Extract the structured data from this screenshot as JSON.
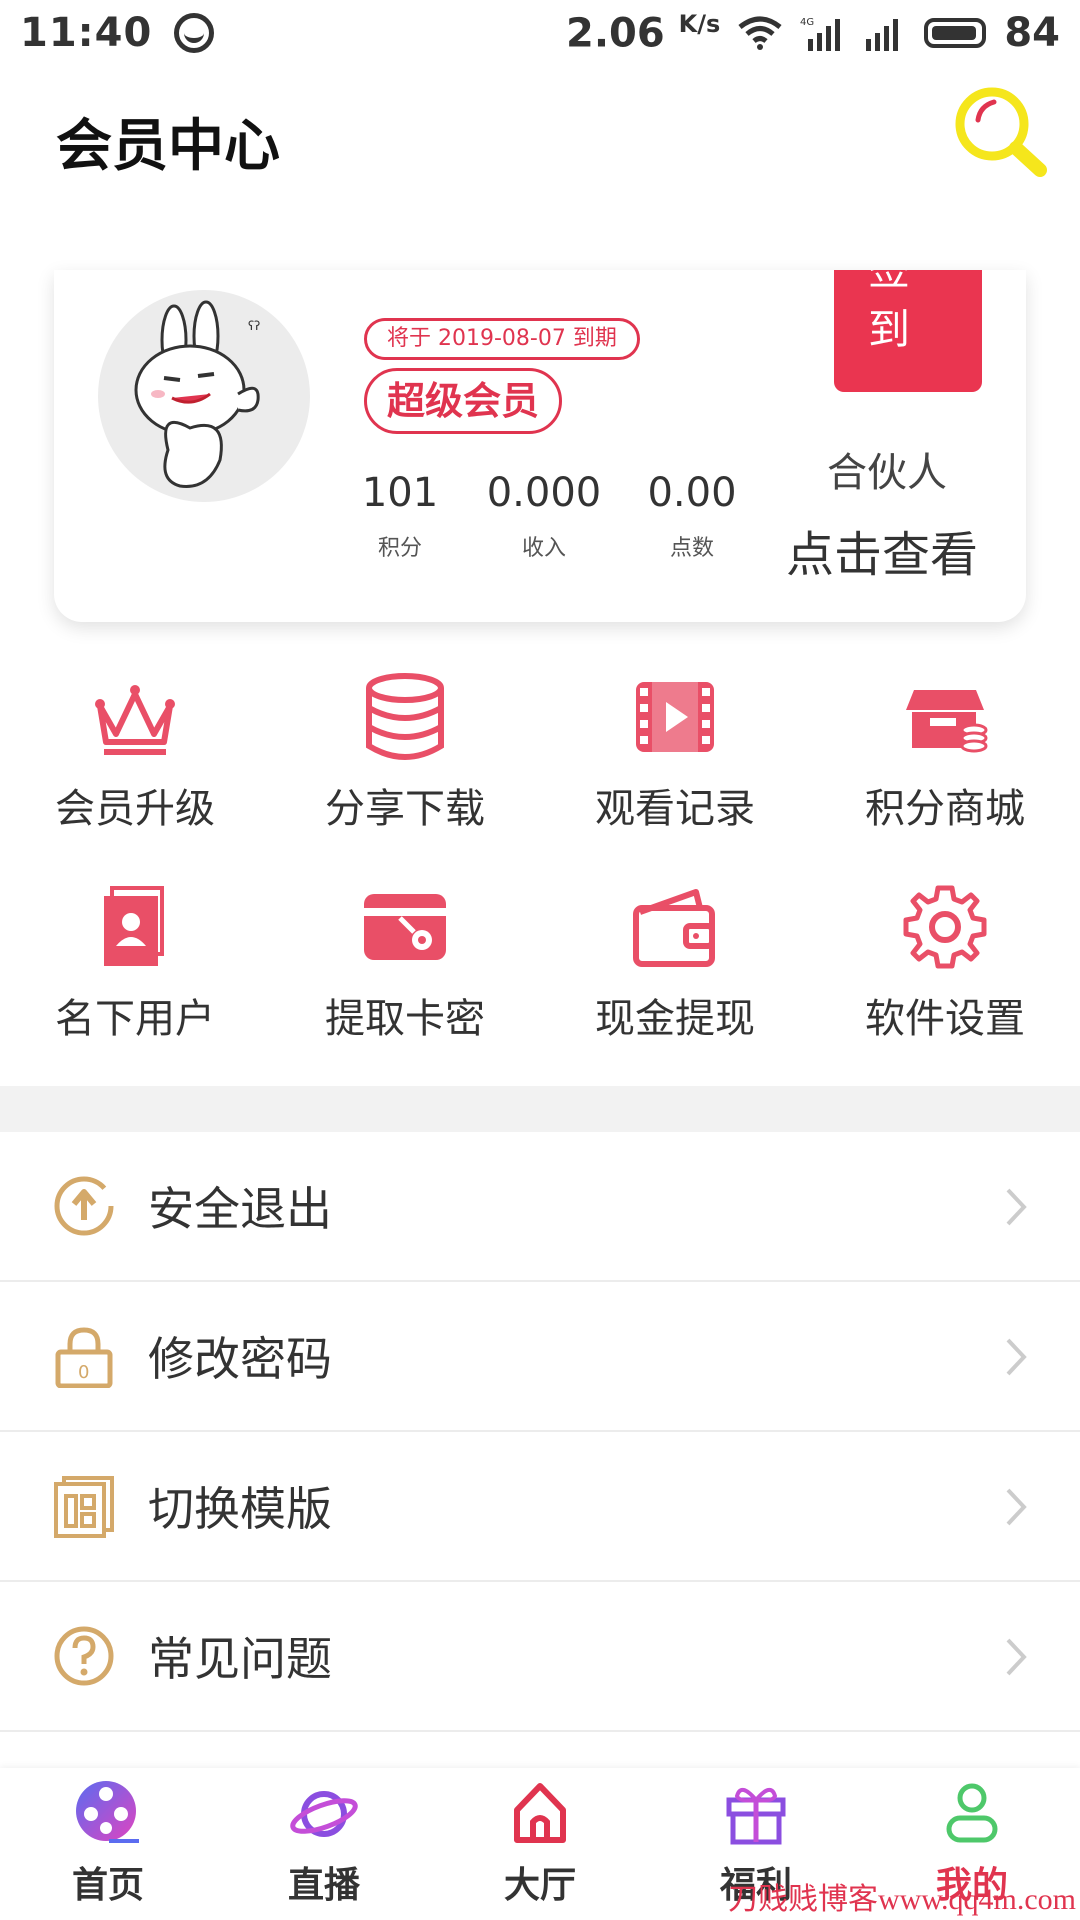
{
  "status_bar": {
    "time": "11:40",
    "speed": "2.06",
    "speed_unit": "K/s",
    "network": "4G",
    "battery": "84"
  },
  "header": {
    "title": "会员中心"
  },
  "member_card": {
    "expire_text": "将于 2019-08-07 到期",
    "level": "超级会员",
    "checkin_line1": "签",
    "checkin_line2": "到",
    "stats": [
      {
        "value": "101",
        "label": "积分"
      },
      {
        "value": "0.000",
        "label": "收入"
      },
      {
        "value": "0.00",
        "label": "点数"
      }
    ],
    "partner_label": "合伙人",
    "partner_link": "点击查看"
  },
  "grid": [
    {
      "label": "会员升级",
      "icon": "crown-icon"
    },
    {
      "label": "分享下载",
      "icon": "database-icon"
    },
    {
      "label": "观看记录",
      "icon": "film-icon"
    },
    {
      "label": "积分商城",
      "icon": "store-icon"
    },
    {
      "label": "名下用户",
      "icon": "contact-card-icon"
    },
    {
      "label": "提取卡密",
      "icon": "card-key-icon"
    },
    {
      "label": "现金提现",
      "icon": "wallet-icon"
    },
    {
      "label": "软件设置",
      "icon": "gear-icon"
    }
  ],
  "menu": [
    {
      "label": "安全退出",
      "icon": "logout-icon"
    },
    {
      "label": "修改密码",
      "icon": "lock-icon"
    },
    {
      "label": "切换模版",
      "icon": "template-icon"
    },
    {
      "label": "常见问题",
      "icon": "question-icon"
    }
  ],
  "tabs": [
    {
      "label": "首页",
      "icon": "film-reel-icon"
    },
    {
      "label": "直播",
      "icon": "planet-icon"
    },
    {
      "label": "大厅",
      "icon": "home-icon"
    },
    {
      "label": "福利",
      "icon": "gift-icon"
    },
    {
      "label": "我的",
      "icon": "user-icon",
      "active": true
    }
  ],
  "watermark": "刀贱贱博客www.qq4m.com",
  "colors": {
    "accent": "#e0344f",
    "icon_pink": "#e94f67",
    "menu_gold": "#d4a96a",
    "search_yellow": "#f5e61c"
  }
}
